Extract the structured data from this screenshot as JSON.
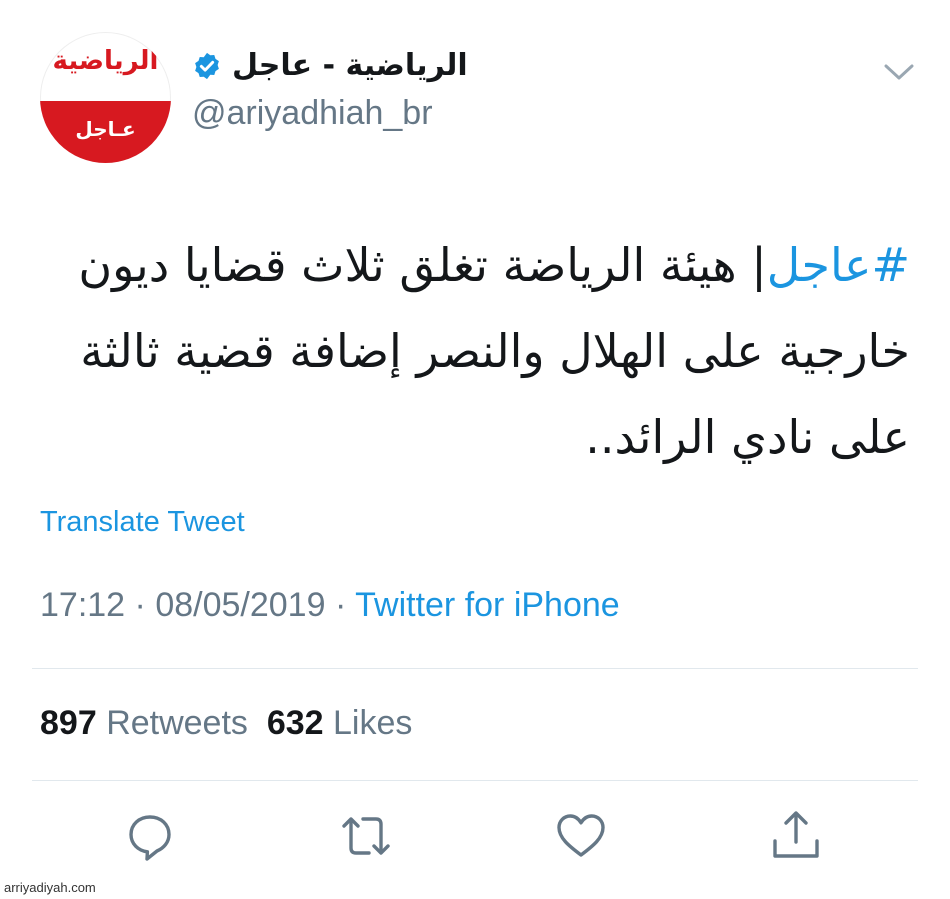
{
  "profile": {
    "avatar_brand": "الرياضية",
    "avatar_label": "عـاجل",
    "display_name": "الرياضية - عاجل",
    "handle": "@ariyadhiah_br"
  },
  "tweet": {
    "hashtag": "#عاجل",
    "body": "| هيئة الرياضة تغلق ثلاث قضايا ديون خارجية على الهلال والنصر إضافة قضية ثالثة على نادي الرائد..",
    "translate_label": "Translate Tweet",
    "time": "17:12",
    "date": "08/05/2019",
    "separator": "·",
    "source": "Twitter for iPhone"
  },
  "stats": {
    "retweets_count": "897",
    "retweets_label": "Retweets",
    "likes_count": "632",
    "likes_label": "Likes"
  },
  "icons": {
    "verified": "verified-badge-icon",
    "menu": "chevron-down-icon",
    "reply": "reply-icon",
    "retweet": "retweet-icon",
    "like": "heart-icon",
    "share": "share-icon"
  },
  "colors": {
    "accent": "#1b95e0",
    "brand_red": "#d71920",
    "text": "#14171a",
    "muted": "#657786"
  },
  "watermark": "arriyadiyah.com"
}
